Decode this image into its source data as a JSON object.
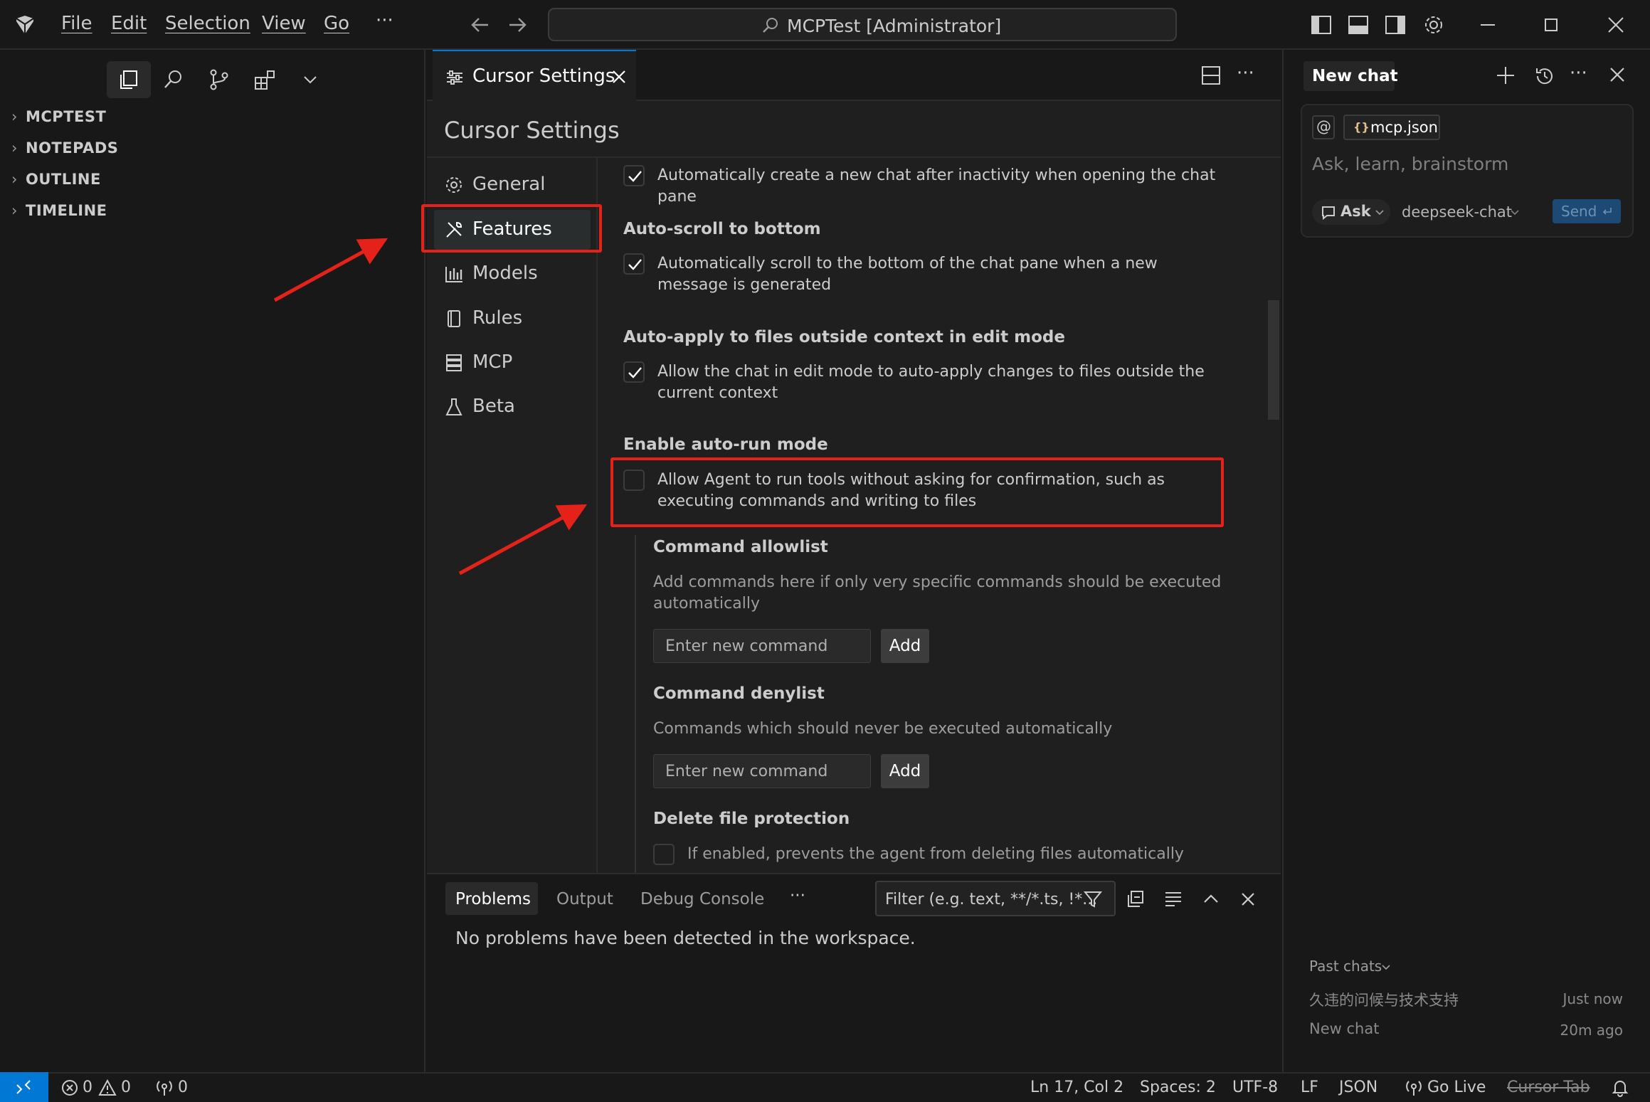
{
  "titlebar": {
    "menu": [
      "File",
      "Edit",
      "Selection",
      "View",
      "Go"
    ],
    "more": "···",
    "command_center": "MCPTest [Administrator]"
  },
  "explorer": {
    "sections": [
      "MCPTEST",
      "NOTEPADS",
      "OUTLINE",
      "TIMELINE"
    ]
  },
  "editor": {
    "tab_label": "Cursor Settings",
    "more": "···"
  },
  "settings": {
    "title": "Cursor Settings",
    "nav": [
      {
        "label": "General",
        "icon": "gear-icon"
      },
      {
        "label": "Features",
        "icon": "tools-icon",
        "active": true
      },
      {
        "label": "Models",
        "icon": "bar-chart-icon"
      },
      {
        "label": "Rules",
        "icon": "book-icon"
      },
      {
        "label": "MCP",
        "icon": "server-icon"
      },
      {
        "label": "Beta",
        "icon": "flask-icon"
      }
    ],
    "items": {
      "auto_new_chat": {
        "desc": "Automatically create a new chat after inactivity when opening the chat pane",
        "checked": true
      },
      "auto_scroll": {
        "title": "Auto-scroll to bottom",
        "desc": "Automatically scroll to the bottom of the chat pane when a new message is generated",
        "checked": true
      },
      "auto_apply": {
        "title": "Auto-apply to files outside context in edit mode",
        "desc": "Allow the chat in edit mode to auto-apply changes to files outside the current context",
        "checked": true
      },
      "auto_run": {
        "title": "Enable auto-run mode",
        "desc": "Allow Agent to run tools without asking for confirmation, such as executing commands and writing to files",
        "checked": false
      },
      "allowlist": {
        "title": "Command allowlist",
        "desc": "Add commands here if only very specific commands should be executed automatically",
        "placeholder": "Enter new command",
        "button": "Add"
      },
      "denylist": {
        "title": "Command denylist",
        "desc": "Commands which should never be executed automatically",
        "placeholder": "Enter new command",
        "button": "Add"
      },
      "delete_protection": {
        "title": "Delete file protection",
        "desc": "If enabled, prevents the agent from deleting files automatically",
        "checked": false
      }
    }
  },
  "panel": {
    "tabs": [
      "Problems",
      "Output",
      "Debug Console"
    ],
    "more": "···",
    "filter_placeholder": "Filter (e.g. text, **/*.ts, !*...",
    "message": "No problems have been detected in the workspace."
  },
  "chat": {
    "tab": "New chat",
    "at": "@",
    "context_file": "mcp.json",
    "context_icon": "{}",
    "placeholder": "Ask, learn, brainstorm",
    "mode": "Ask",
    "model": "deepseek-chat",
    "send": "Send",
    "past_chats_label": "Past chats",
    "past_chats": [
      {
        "title": "久违的问候与技术支持",
        "time": "Just now"
      },
      {
        "title": "New chat",
        "time": "20m ago"
      }
    ]
  },
  "statusbar": {
    "errors": "0",
    "warnings": "0",
    "ports": "0",
    "position": "Ln 17, Col 2",
    "spaces": "Spaces: 2",
    "encoding": "UTF-8",
    "eol": "LF",
    "language": "JSON",
    "go_live": "Go Live",
    "cursor_tab": "Cursor Tab"
  },
  "colors": {
    "accent": "#0078d4",
    "annotation_red": "#e5221a",
    "background": "#1f1f1f"
  }
}
